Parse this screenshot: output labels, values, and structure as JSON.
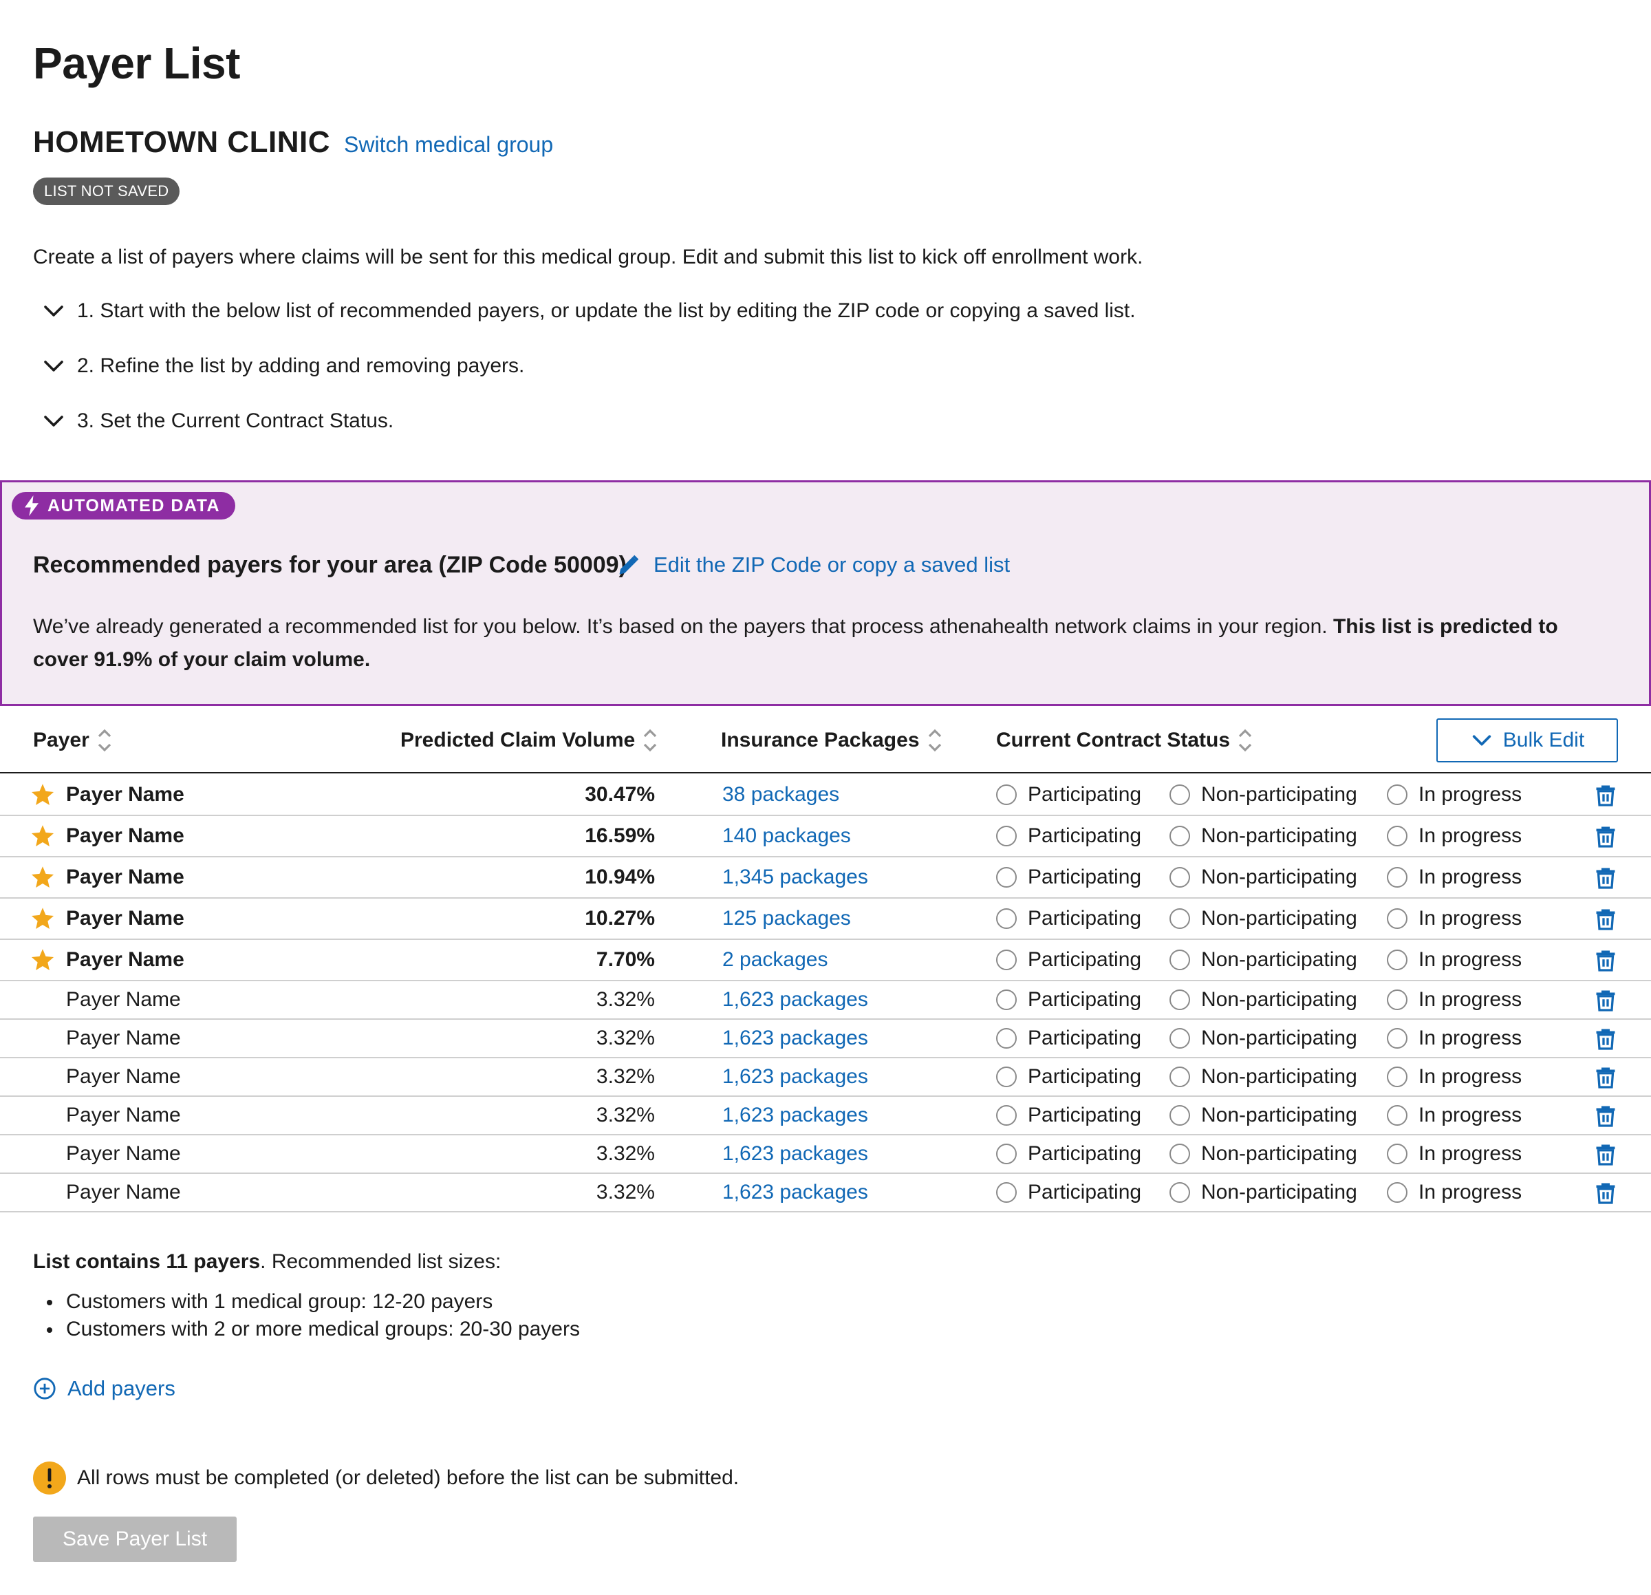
{
  "page": {
    "title": "Payer List",
    "group_name": "HOMETOWN CLINIC",
    "switch_link": "Switch medical group",
    "status_badge": "LIST NOT SAVED",
    "intro": "Create a list of payers where claims will be sent for this medical group. Edit and submit this list to kick off enrollment work.",
    "steps": [
      "1. Start with the below list of recommended payers, or update the list by editing the ZIP code or copying a saved list.",
      "2. Refine the list by adding and removing payers.",
      "3. Set the Current Contract Status."
    ]
  },
  "automated": {
    "badge": "AUTOMATED DATA",
    "title": "Recommended payers for your area (ZIP Code 50009)",
    "edit_link": "Edit the ZIP Code or copy a saved list",
    "description": "We’ve already generated a recommended list for you below. It’s based on the payers that process athenahealth network claims in your region. ",
    "description_bold": "This list is predicted to cover 91.9% of your claim volume."
  },
  "table": {
    "headers": {
      "payer": "Payer",
      "volume": "Predicted Claim Volume",
      "packages": "Insurance Packages",
      "status": "Current Contract Status"
    },
    "bulk_edit": "Bulk Edit",
    "status_options": [
      "Participating",
      "Non-participating",
      "In progress"
    ],
    "rows": [
      {
        "payer": "Payer Name",
        "volume": "30.47%",
        "packages": "38 packages",
        "starred": true
      },
      {
        "payer": "Payer Name",
        "volume": "16.59%",
        "packages": "140 packages",
        "starred": true
      },
      {
        "payer": "Payer Name",
        "volume": "10.94%",
        "packages": "1,345 packages",
        "starred": true
      },
      {
        "payer": "Payer Name",
        "volume": "10.27%",
        "packages": "125 packages",
        "starred": true
      },
      {
        "payer": "Payer Name",
        "volume": "7.70%",
        "packages": "2 packages",
        "starred": true
      },
      {
        "payer": "Payer Name",
        "volume": "3.32%",
        "packages": "1,623 packages",
        "starred": false
      },
      {
        "payer": "Payer Name",
        "volume": "3.32%",
        "packages": "1,623 packages",
        "starred": false
      },
      {
        "payer": "Payer Name",
        "volume": "3.32%",
        "packages": "1,623 packages",
        "starred": false
      },
      {
        "payer": "Payer Name",
        "volume": "3.32%",
        "packages": "1,623 packages",
        "starred": false
      },
      {
        "payer": "Payer Name",
        "volume": "3.32%",
        "packages": "1,623 packages",
        "starred": false
      },
      {
        "payer": "Payer Name",
        "volume": "3.32%",
        "packages": "1,623 packages",
        "starred": false
      }
    ]
  },
  "footer": {
    "summary_bold": "List contains 11 payers",
    "summary_rest": ". Recommended list sizes:",
    "recommendations": [
      "Customers with 1 medical group: 12-20 payers",
      "Customers with 2 or more medical groups: 20-30 payers"
    ],
    "add_payers": "Add payers",
    "warning": "All rows must be completed (or deleted) before the list can be submitted.",
    "save_button": "Save Payer List"
  },
  "colors": {
    "link": "#1168b5",
    "automated_accent": "#8e2da3",
    "automated_bg": "#f3ebf3",
    "star": "#f2a71b",
    "warning": "#f2a71b",
    "disabled_button": "#b9b9b9"
  },
  "icons": [
    "chevron-down-icon",
    "lightning-icon",
    "pencil-icon",
    "sort-icon",
    "star-icon",
    "trash-icon",
    "plus-circle-icon",
    "warning-icon"
  ]
}
